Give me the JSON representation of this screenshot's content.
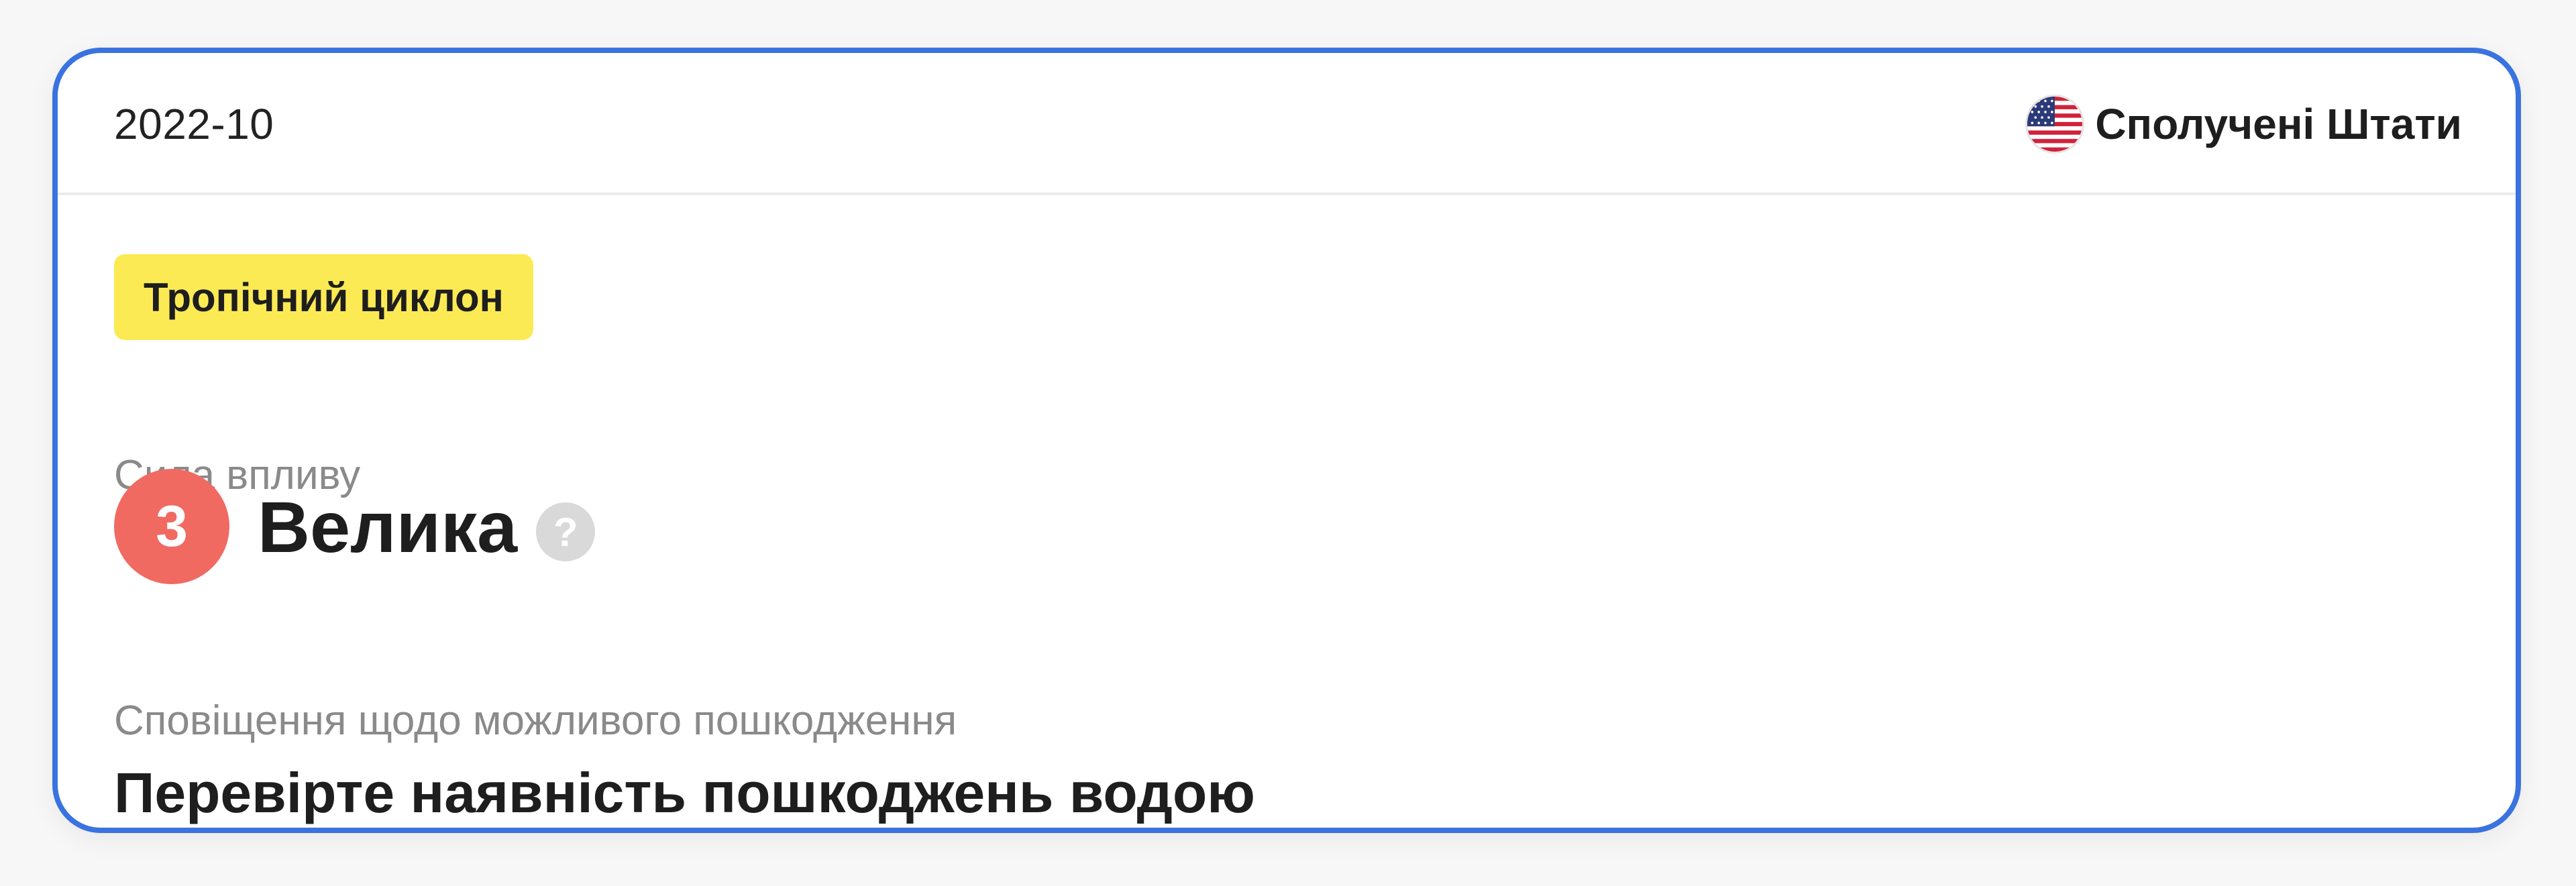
{
  "card": {
    "date": "2022-10",
    "country": {
      "name": "Сполучені Штати",
      "flag_icon": "us-flag-icon"
    },
    "event_type": "Тропічний циклон",
    "impact": {
      "label": "Сила впливу",
      "level": "3",
      "level_text": "Велика",
      "help_icon": "question-icon",
      "help_glyph": "?"
    },
    "alert": {
      "label": "Сповіщення щодо можливого пошкодження",
      "text": "Перевірте наявність пошкоджень водою"
    }
  },
  "colors": {
    "card_border": "#3a73e0",
    "tag_background": "#fcea55",
    "level_circle": "#f06a62",
    "muted_text": "#8a8a8a"
  }
}
